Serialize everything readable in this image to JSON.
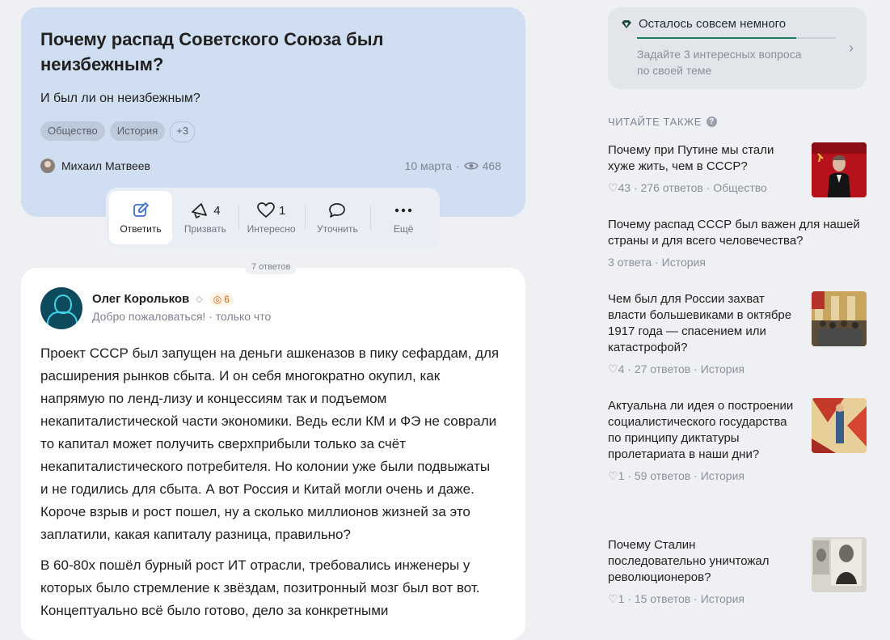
{
  "question": {
    "title": "Почему распад Советского Союза был неизбежным?",
    "subtitle": "И был ли он неизбежным?",
    "tags": [
      "Общество",
      "История"
    ],
    "tags_more": "+3",
    "author": "Михаил Матвеев",
    "date": "10 марта",
    "views": "468"
  },
  "actions": {
    "answer": "Ответить",
    "call": "Призвать",
    "call_count": "4",
    "interesting": "Интересно",
    "interesting_count": "1",
    "clarify": "Уточнить",
    "more": "Ещё"
  },
  "answers_count": "7 ответов",
  "answer": {
    "author": "Олег Корольков",
    "badge_count": "6",
    "status": "Добро пожаловаться!",
    "time": "только что",
    "paragraphs": [
      "Проект СССР был запущен на деньги ашкеназов в пику сефардам, для расширения рынков сбыта. И он себя многократно окупил, как напрямую по ленд-лизу и концессиям так и подъемом некапиталистической части экономики. Ведь если КМ и ФЭ не соврали то капитал может получить сверхприбыли только за счёт некапиталистического потребителя. Но колонии уже были подвыжаты и не годились для сбыта. А вот Россия и Китай могли очень и даже. Короче взрыв и рост пошел, ну а сколько миллионов жизней за это заплатили, какая капиталу разница, правильно?",
      "В 60-80х пошёл бурный рост ИТ отрасли, требовались инженеры у которых было стремление к звёздам, позитронный мозг был вот вот. Концептуально всё было готово, дело за конкретными"
    ]
  },
  "promo": {
    "title": "Осталось совсем немного",
    "text": "Задайте 3 интересных вопроса по своей теме",
    "progress": 0.8
  },
  "read_also": {
    "heading": "ЧИТАЙТЕ ТАКЖЕ",
    "items": [
      {
        "title": "Почему при Путине мы стали хуже жить, чем в СССР?",
        "likes": "43",
        "answers": "276 ответов",
        "category": "Общество"
      },
      {
        "title": "Почему распад СССР был важен для нашей страны и для всего человечества?",
        "answers": "3 ответа",
        "category": "История"
      },
      {
        "title": "Чем был для России захват власти большевиками в октябре 1917 года — спасением или катастрофой?",
        "likes": "4",
        "answers": "27 ответов",
        "category": "История"
      },
      {
        "title": "Актуальна ли идея о построении социалистического государства по принципу диктатуры пролетариата в наши дни?",
        "likes": "1",
        "answers": "59 ответов",
        "category": "История"
      },
      {
        "title": "Почему Сталин последовательно уничтожал революционеров?",
        "likes": "1",
        "answers": "15 ответов",
        "category": "История"
      }
    ]
  },
  "colors": {
    "question_card": "#cfdff1",
    "page_bg": "#eef0f4",
    "promo_accent": "#1c7c62"
  }
}
